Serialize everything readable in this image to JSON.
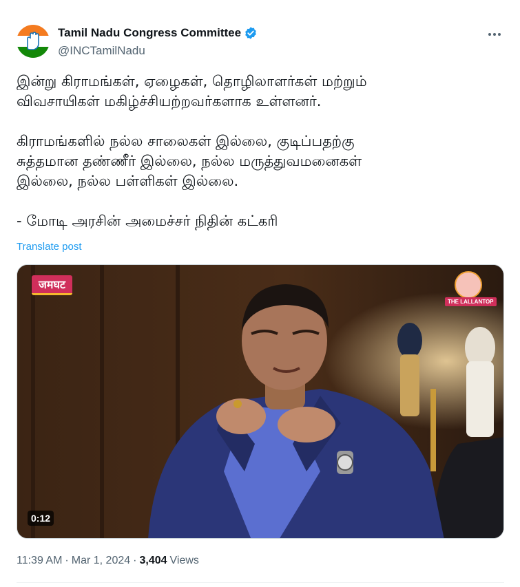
{
  "author": {
    "display_name": "Tamil Nadu Congress Committee",
    "handle": "@INCTamilNadu",
    "verified": true,
    "avatar_icon": "congress-hand-logo",
    "verified_icon": "verified-badge-icon",
    "verified_color": "#1d9bf0"
  },
  "more_icon": "more-horizontal-icon",
  "post_text": {
    "para1": "இன்று கிராமங்கள், ஏழைகள், தொழிலாளர்கள் மற்றும்\nவிவசாயிகள் மகிழ்ச்சியற்றவர்களாக உள்ளனர்.",
    "para2": "கிராமங்களில் நல்ல சாலைகள் இல்லை, குடிப்பதற்கு\nசுத்தமான தண்ணீர் இல்லை, நல்ல மருத்துவமனைகள்\nஇல்லை, நல்ல பள்ளிகள் இல்லை.",
    "para3": "- மோடி அரசின் அமைச்சர் நிதின் கட்கரி"
  },
  "translate_label": "Translate post",
  "video": {
    "duration": "0:12",
    "brand_left": "जमघट",
    "brand_right": "THE LALLANTOP"
  },
  "meta": {
    "time": "11:39 AM",
    "separator": "·",
    "date": "Mar 1, 2024",
    "views_count": "3,404",
    "views_label": "Views"
  },
  "colors": {
    "link": "#1d9bf0",
    "secondary_text": "#536471",
    "primary_text": "#0f1419"
  }
}
